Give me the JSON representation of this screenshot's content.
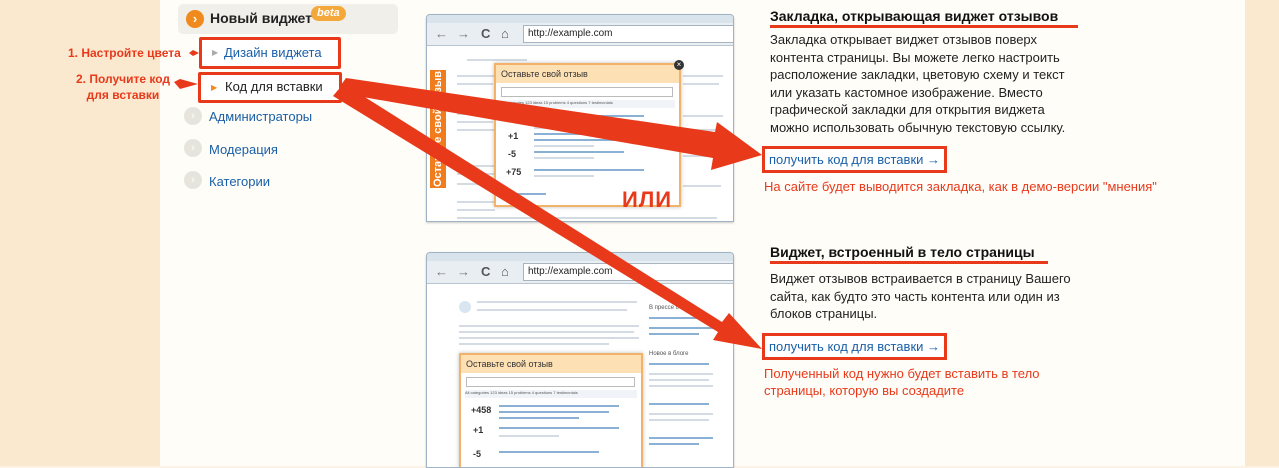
{
  "sidebar": {
    "header": {
      "title": "Новый виджет",
      "badge": "beta"
    },
    "items": [
      {
        "label": "Дизайн виджета",
        "step": "1. Настройте цвета"
      },
      {
        "label": "Код для вставки",
        "step": "2. Получите код\nдля вставки"
      },
      {
        "label": "Администраторы"
      },
      {
        "label": "Модерация"
      },
      {
        "label": "Категории"
      }
    ]
  },
  "browser": {
    "url": "http://example.com",
    "nav": {
      "back": "←",
      "forward": "→",
      "reload": "C",
      "home": "⌂"
    }
  },
  "widget": {
    "title": "Оставьте свой отзыв",
    "tab_label": "Оставьте свой отзыв",
    "tabs_text": "All categories   123 ideas   15 problems   4 questions   7 testimonials",
    "votes": [
      "+458",
      "+1",
      "-5",
      "+75"
    ],
    "votes_inline": [
      "+458",
      "+1",
      "-5"
    ],
    "blog_heading": "В прессе о нас",
    "blog_heading2": "Новое в блоге"
  },
  "or_label": "ИЛИ",
  "sections": [
    {
      "title": "Закладка, открывающая виджет отзывов",
      "description": "Закладка открывает виджет отзывов поверх контента страницы. Вы можете легко настроить расположение закладки, цветовую схему и текст или указать кастомное изображение. Вместо графической закладки для открытия виджета можно использовать обычную текстовую ссылку.",
      "link": "получить код для вставки →",
      "note": "На сайте будет выводится закладка, как в демо-версии \"мнения\""
    },
    {
      "title": "Виджет, встроенный в тело страницы",
      "description": "Виджет отзывов встраивается в страницу Вашего сайта, как будто это часть контента или один из блоков страницы.",
      "link": "получить код для вставки →",
      "note": "Полученный код нужно будет вставить в тело страницы, которую вы создадите"
    }
  ],
  "colors": {
    "accent": "#e8391b",
    "orange": "#f08a1c",
    "link": "#1a5fa8",
    "background": "#fdf3e4"
  }
}
